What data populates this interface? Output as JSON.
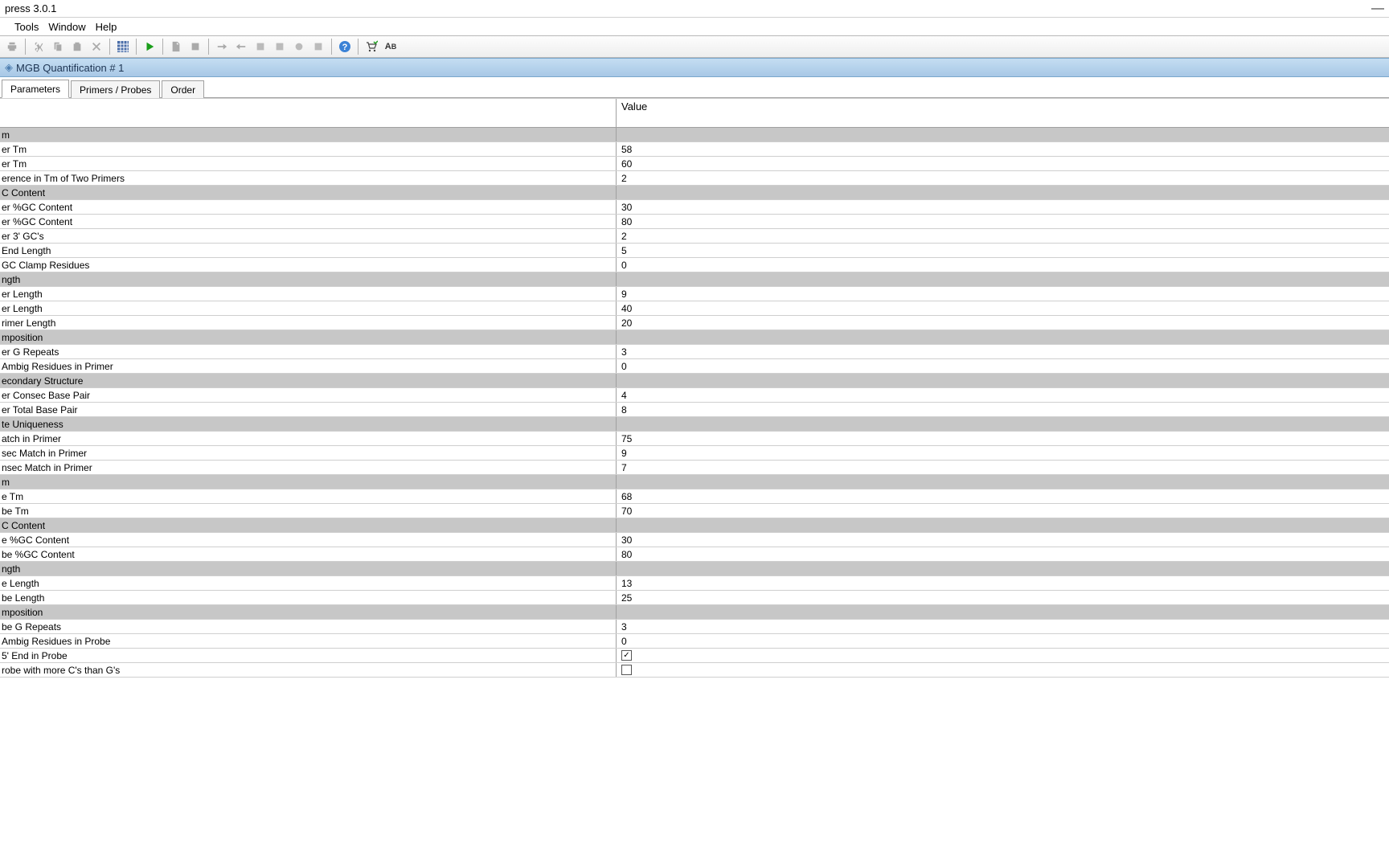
{
  "window": {
    "title": "press 3.0.1"
  },
  "menu": {
    "items": [
      "",
      "Tools",
      "Window",
      "Help"
    ]
  },
  "document": {
    "title": "MGB Quantification # 1"
  },
  "tabs": [
    {
      "label": "Parameters",
      "active": true
    },
    {
      "label": "Primers / Probes",
      "active": false
    },
    {
      "label": "Order",
      "active": false
    }
  ],
  "table": {
    "header_value": "Value",
    "rows": [
      {
        "type": "section",
        "label": "m",
        "value": ""
      },
      {
        "type": "data",
        "label": "er Tm",
        "value": "58"
      },
      {
        "type": "data",
        "label": "er Tm",
        "value": "60"
      },
      {
        "type": "data",
        "label": "erence in Tm of Two Primers",
        "value": "2"
      },
      {
        "type": "section",
        "label": "C Content",
        "value": ""
      },
      {
        "type": "data",
        "label": "er %GC Content",
        "value": "30"
      },
      {
        "type": "data",
        "label": "er %GC Content",
        "value": "80"
      },
      {
        "type": "data",
        "label": "er 3' GC's",
        "value": "2"
      },
      {
        "type": "data",
        "label": "End Length",
        "value": "5"
      },
      {
        "type": "data",
        "label": "GC Clamp Residues",
        "value": "0"
      },
      {
        "type": "section",
        "label": "ngth",
        "value": ""
      },
      {
        "type": "data",
        "label": "er Length",
        "value": "9"
      },
      {
        "type": "data",
        "label": "er Length",
        "value": "40"
      },
      {
        "type": "data",
        "label": "rimer Length",
        "value": "20"
      },
      {
        "type": "section",
        "label": "mposition",
        "value": ""
      },
      {
        "type": "data",
        "label": "er G Repeats",
        "value": "3"
      },
      {
        "type": "data",
        "label": "Ambig Residues in Primer",
        "value": "0"
      },
      {
        "type": "section",
        "label": "econdary Structure",
        "value": ""
      },
      {
        "type": "data",
        "label": "er Consec Base Pair",
        "value": "4"
      },
      {
        "type": "data",
        "label": "er Total Base Pair",
        "value": "8"
      },
      {
        "type": "section",
        "label": "te Uniqueness",
        "value": ""
      },
      {
        "type": "data",
        "label": "atch in Primer",
        "value": "75"
      },
      {
        "type": "data",
        "label": "sec Match in Primer",
        "value": "9"
      },
      {
        "type": "data",
        "label": "nsec Match in Primer",
        "value": "7"
      },
      {
        "type": "section",
        "label": "m",
        "value": ""
      },
      {
        "type": "data",
        "label": "e Tm",
        "value": "68"
      },
      {
        "type": "data",
        "label": "be Tm",
        "value": "70"
      },
      {
        "type": "section",
        "label": "C Content",
        "value": ""
      },
      {
        "type": "data",
        "label": "e %GC Content",
        "value": "30"
      },
      {
        "type": "data",
        "label": "be %GC Content",
        "value": "80"
      },
      {
        "type": "section",
        "label": "ngth",
        "value": ""
      },
      {
        "type": "data",
        "label": "e Length",
        "value": "13"
      },
      {
        "type": "data",
        "label": "be Length",
        "value": "25"
      },
      {
        "type": "section",
        "label": "mposition",
        "value": ""
      },
      {
        "type": "data",
        "label": "be G Repeats",
        "value": "3"
      },
      {
        "type": "data",
        "label": "Ambig Residues in Probe",
        "value": "0"
      },
      {
        "type": "checkbox",
        "label": "5' End in Probe",
        "checked": true
      },
      {
        "type": "checkbox",
        "label": "robe with more C's than G's",
        "checked": false
      }
    ]
  }
}
